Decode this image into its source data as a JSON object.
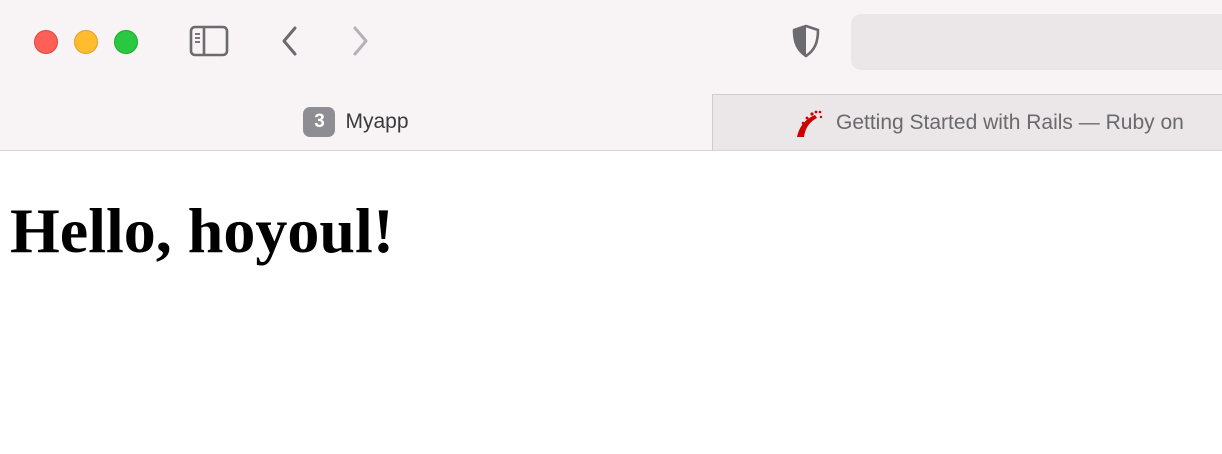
{
  "window": {
    "traffic_lights": [
      "close",
      "minimize",
      "zoom"
    ]
  },
  "toolbar": {
    "icons": [
      "sidebar-icon",
      "chevron-left-icon",
      "chevron-right-icon",
      "privacy-shield-icon"
    ],
    "address_value": ""
  },
  "tabs": [
    {
      "badge": "3",
      "label": "Myapp",
      "active": true
    },
    {
      "label": "Getting Started with Rails — Ruby on",
      "favicon": "rails-icon",
      "active": false
    }
  ],
  "page": {
    "heading": "Hello, hoyoul!"
  },
  "colors": {
    "chrome_bg": "#f8f3f4",
    "inactive_tab_bg": "#ebe6e7",
    "close": "#fe5f57",
    "minimize": "#febc2e",
    "zoom": "#28c840",
    "rails_red": "#cc0000"
  }
}
